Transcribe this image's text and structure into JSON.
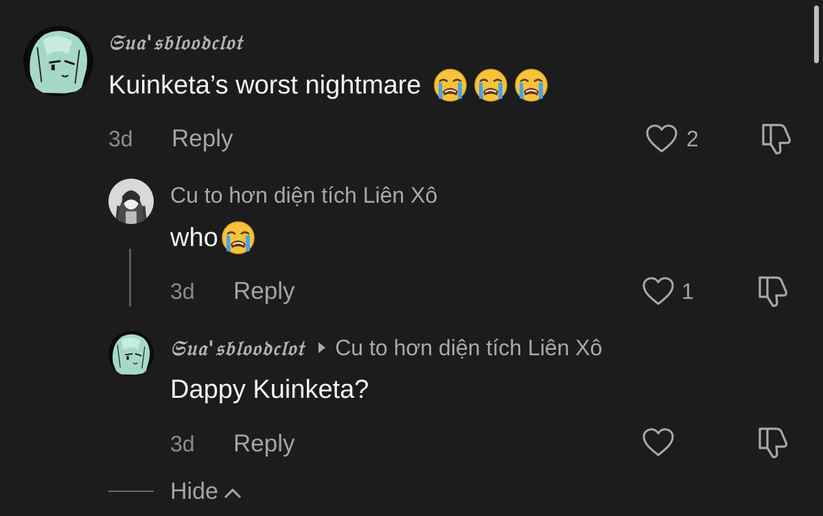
{
  "comments": [
    {
      "username": "𝔖𝔲𝔞'𝔰𝔟𝔩𝔬𝔬𝔡𝔠𝔩𝔬𝔱",
      "text": "Kuinketa’s worst nightmare",
      "emojis": [
        "loudly-crying-face",
        "loudly-crying-face",
        "loudly-crying-face"
      ],
      "time": "3d",
      "reply_label": "Reply",
      "likes": "2"
    },
    {
      "username": "Cu to hơn diện tích Liên Xô",
      "text": "who",
      "emojis": [
        "loudly-crying-face"
      ],
      "time": "3d",
      "reply_label": "Reply",
      "likes": "1"
    },
    {
      "username": "𝔖𝔲𝔞'𝔰𝔟𝔩𝔬𝔬𝔡𝔠𝔩𝔬𝔱",
      "reply_to": "Cu to hơn diện tích Liên Xô",
      "text": "Dappy Kuinketa?",
      "time": "3d",
      "reply_label": "Reply",
      "likes": ""
    }
  ],
  "hide_label": "Hide",
  "icons": {
    "like": "heart-outline-icon",
    "dislike": "thumbs-down-outline-icon",
    "hide": "chevron-up-icon",
    "reply_to": "triangle-right-icon"
  },
  "colors": {
    "background": "#1c1c1c",
    "avatar_tint": "#a6d8c8",
    "emoji_yellow": "#f7c33a",
    "emoji_tears": "#4aa3e8"
  }
}
